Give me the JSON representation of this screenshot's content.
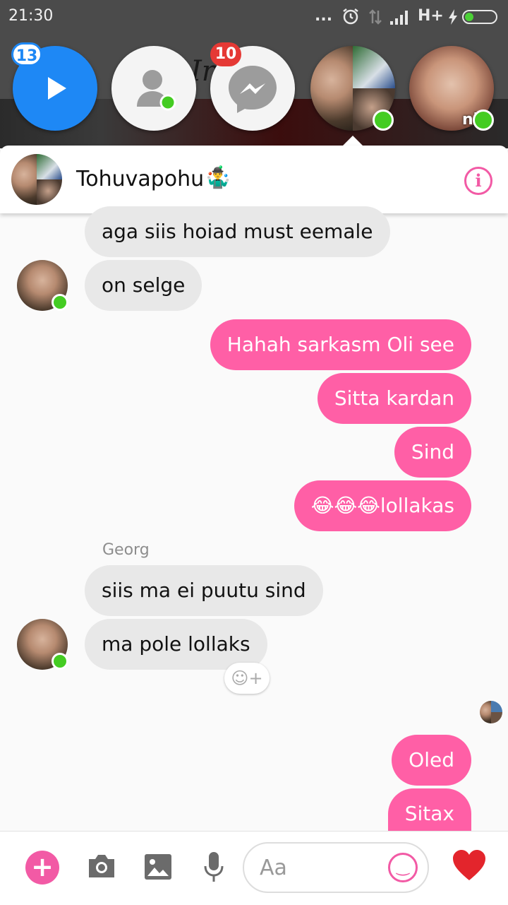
{
  "status_bar": {
    "time": "21:30",
    "dots": "...",
    "network": "H+"
  },
  "background_title": "In...m",
  "chat_heads": [
    {
      "name": "video-head",
      "badge": "13"
    },
    {
      "name": "contacts-head"
    },
    {
      "name": "messenger-head",
      "badge": "10"
    },
    {
      "name": "tohuvapohu-head",
      "online": true
    },
    {
      "name": "person-head",
      "label": "ni",
      "online": true
    }
  ],
  "conversation": {
    "name": "Tohuvapohu",
    "emoji": "🤹‍♂️"
  },
  "messages": [
    {
      "side": "in",
      "text": "aga siis hoiad must eemale"
    },
    {
      "side": "in",
      "text": "on selge"
    },
    {
      "side": "out",
      "text": "Hahah sarkasm Oli see"
    },
    {
      "side": "out",
      "text": "Sitta kardan"
    },
    {
      "side": "out",
      "text": "Sind"
    },
    {
      "side": "out",
      "text": "😂😂😂lollakas"
    },
    {
      "side": "in",
      "sender": "Georg",
      "text": "siis ma ei puutu sind"
    },
    {
      "side": "in",
      "text": "ma pole lollaks"
    },
    {
      "side": "out",
      "text": "Oled"
    },
    {
      "side": "out",
      "text": "Sitax"
    }
  ],
  "composer": {
    "placeholder": "Aa"
  },
  "colors": {
    "accent": "#ff5fa6",
    "online": "#44cc22",
    "messenger_blue": "#1e88f5"
  }
}
